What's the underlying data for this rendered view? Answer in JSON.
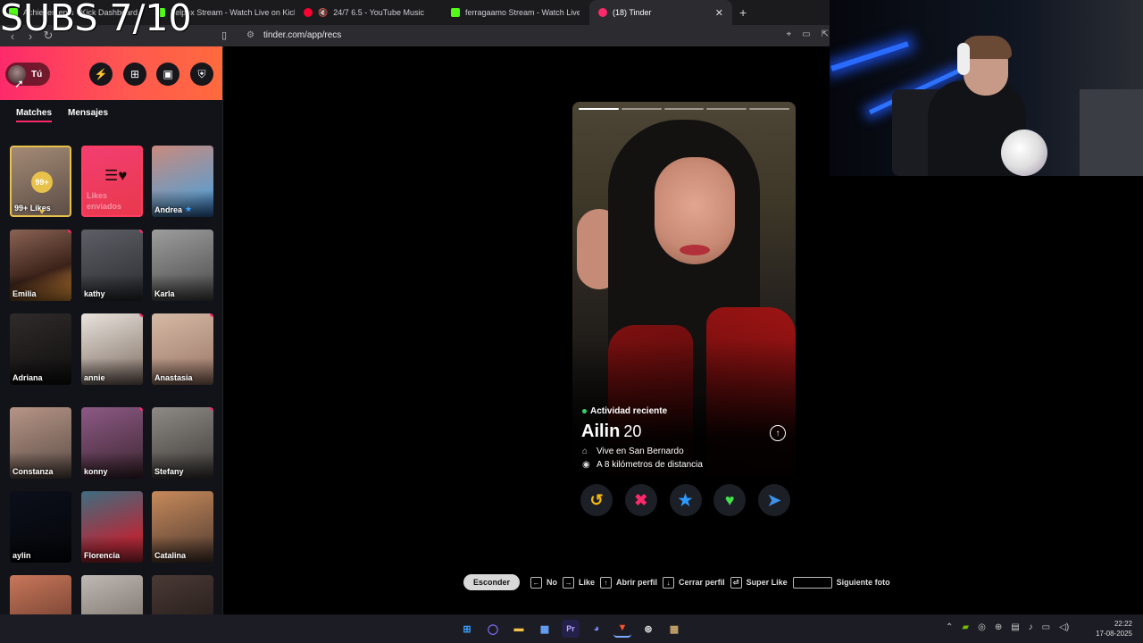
{
  "overlay": {
    "text": "SUBS 7/10"
  },
  "tabs": [
    {
      "label": "Achievements · Kick Dashboard",
      "color": "#53fc18"
    },
    {
      "label": "Yelpox Stream - Watch Live on Kick",
      "color": "#53fc18"
    },
    {
      "label": "24/7 6.5 - YouTube Music",
      "color": "#ff0033"
    },
    {
      "label": "ferragaamo Stream - Watch Live on Kick",
      "color": "#53fc18"
    },
    {
      "label": "(18) Tinder",
      "color": "#fd2a6b"
    }
  ],
  "address": {
    "url": "tinder.com/app/recs"
  },
  "sidebar": {
    "profile_label": "Tú",
    "tabs": [
      "Matches",
      "Mensajes"
    ],
    "likes_card": {
      "badge": "99+",
      "label": "99+ Likes"
    },
    "sent_card": {
      "label": "Likes enviados"
    },
    "matches": [
      {
        "name": "Andrea",
        "verified": true,
        "dot": false,
        "bg": "linear-gradient(160deg,#c98a7d,#6a9bc4 70%,#2e6fb6)"
      },
      {
        "name": "Emilia",
        "dot": true,
        "bg": "linear-gradient(160deg,#8a6355,#3b2219 60%,#f4a040)"
      },
      {
        "name": "kathy",
        "dot": true,
        "bg": "linear-gradient(160deg,#5d5f66,#2b2c31)"
      },
      {
        "name": "Karla",
        "dot": false,
        "bg": "linear-gradient(160deg,#9d9d9d,#4a4a4a)"
      },
      {
        "name": "Adriana",
        "dot": false,
        "bg": "linear-gradient(160deg,#2f2b2a,#0f0e0e)"
      },
      {
        "name": "annie",
        "dot": true,
        "bg": "linear-gradient(160deg,#e8e3dc,#7d6c62)"
      },
      {
        "name": "Anastasia",
        "dot": true,
        "bg": "linear-gradient(160deg,#d5b9a5,#9a7566)"
      },
      {
        "name": "Constanza",
        "dot": false,
        "bg": "linear-gradient(160deg,#b69586,#5b4c46)"
      },
      {
        "name": "konny",
        "dot": true,
        "bg": "linear-gradient(160deg,#8c5a85,#3d2530)"
      },
      {
        "name": "Stefany",
        "dot": true,
        "bg": "linear-gradient(160deg,#8e8a85,#3e3b38)"
      },
      {
        "name": "aylin",
        "dot": false,
        "bg": "linear-gradient(160deg,#0c0f1a,#05060a)"
      },
      {
        "name": "Florencia",
        "dot": false,
        "bg": "linear-gradient(160deg,#3d6e80,#b42a3a 70%)"
      },
      {
        "name": "Catalina",
        "dot": false,
        "bg": "linear-gradient(160deg,#c78a5b,#4f3a30)"
      },
      {
        "name": "",
        "dot": false,
        "bg": "linear-gradient(160deg,#c9775a,#5b3226)"
      },
      {
        "name": "",
        "dot": false,
        "bg": "linear-gradient(160deg,#bfb9b3,#6b625b)"
      },
      {
        "name": "",
        "dot": false,
        "bg": "linear-gradient(160deg,#4a3a35,#1c1513)"
      }
    ]
  },
  "profile": {
    "activity": "Actividad reciente",
    "name": "Ailin",
    "age": "20",
    "lives": "Vive en San Bernardo",
    "distance": "A 8 kilómetros de distancia",
    "photo_count": 5,
    "current_photo": 1
  },
  "actions": [
    {
      "name": "rewind-button",
      "glyph": "↺",
      "color": "#f5b80f"
    },
    {
      "name": "nope-button",
      "glyph": "✖",
      "color": "#fd2a6b"
    },
    {
      "name": "super-like-button",
      "glyph": "★",
      "color": "#2b9bff"
    },
    {
      "name": "like-button",
      "glyph": "♥",
      "color": "#44e04c"
    },
    {
      "name": "boost-button",
      "glyph": "➤",
      "color": "#3d8fe8"
    }
  ],
  "hints": {
    "hide": "Esconder",
    "items": [
      {
        "key": "←",
        "label": "No"
      },
      {
        "key": "→",
        "label": "Like"
      },
      {
        "key": "↑",
        "label": "Abrir perfil"
      },
      {
        "key": "↓",
        "label": "Cerrar perfil"
      },
      {
        "key": "⏎",
        "label": "Super Like"
      },
      {
        "key": "",
        "label": "Siguiente foto",
        "space": true
      }
    ]
  },
  "taskbar": {
    "time": "22:22",
    "date": "17-08-2025"
  }
}
